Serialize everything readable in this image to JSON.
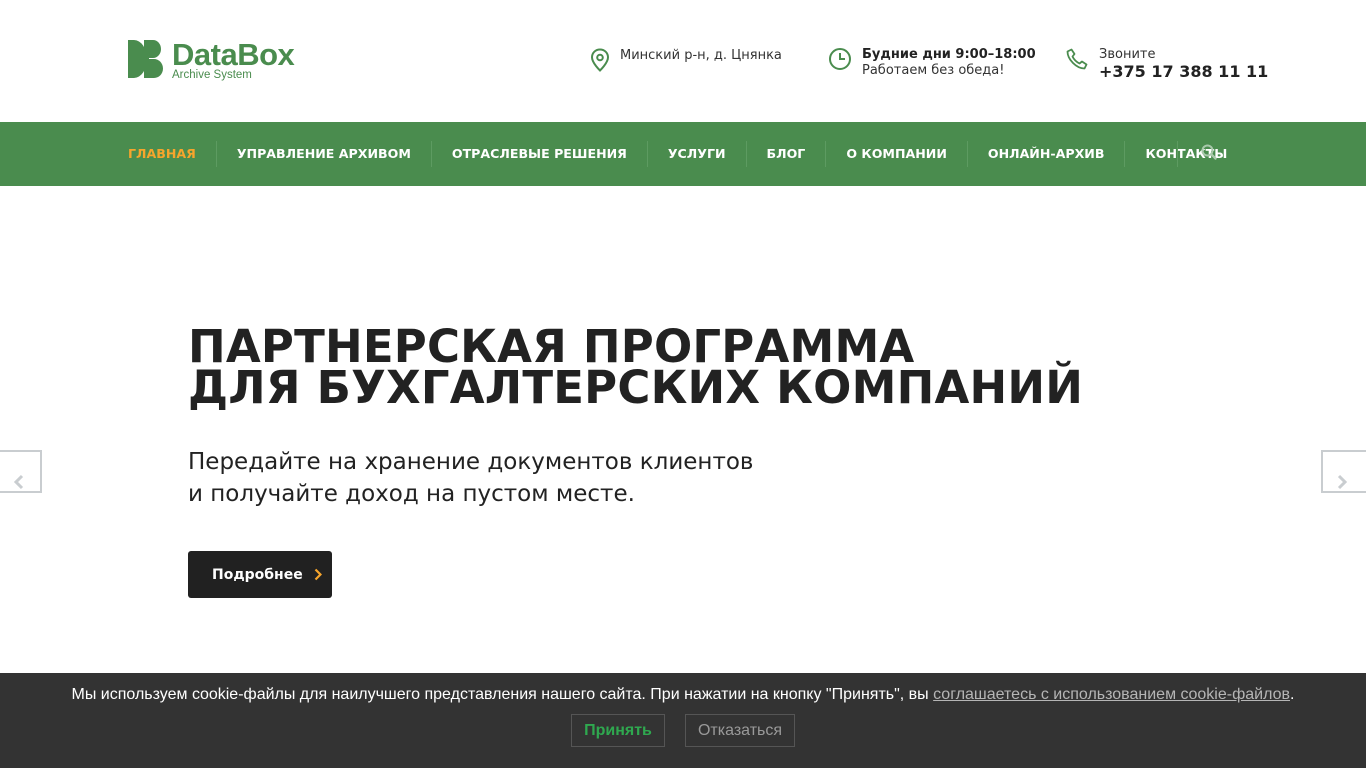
{
  "header": {
    "logo": {
      "name": "DataBox",
      "tagline": "Archive System"
    },
    "location": {
      "icon": "map-pin-icon",
      "text": "Минский р-н, д. Цнянка"
    },
    "hours": {
      "icon": "clock-icon",
      "title": "Будние дни 9:00–18:00",
      "note": "Работаем без обеда!"
    },
    "phone": {
      "icon": "phone-icon",
      "label": "Звоните",
      "number": "+375 17 388 11 11"
    }
  },
  "nav": {
    "items": [
      {
        "label": "ГЛАВНАЯ",
        "active": true
      },
      {
        "label": "УПРАВЛЕНИЕ АРХИВОМ"
      },
      {
        "label": "ОТРАСЛЕВЫЕ РЕШЕНИЯ"
      },
      {
        "label": "УСЛУГИ"
      },
      {
        "label": "БЛОГ"
      },
      {
        "label": "О КОМПАНИИ"
      },
      {
        "label": "ОНЛАЙН-АРХИВ"
      },
      {
        "label": "КОНТАКТЫ"
      }
    ],
    "search_icon": "search-icon"
  },
  "hero": {
    "title_line1": "ПАРТНЕРСКАЯ ПРОГРАММА",
    "title_line2": "ДЛЯ БУХГАЛТЕРСКИХ КОМПАНИЙ",
    "subtitle_line1": "Передайте на хранение документов клиентов",
    "subtitle_line2": "и получайте доход на пустом месте.",
    "button_label": "Подробнее"
  },
  "slider": {
    "prev_icon": "chevron-left-icon",
    "next_icon": "chevron-right-icon"
  },
  "cookie": {
    "text": "Мы используем cookie-файлы для наилучшего представления нашего сайта. При нажатии на кнопку \"Принять\", вы ",
    "link": "соглашаетесь с использованием cookie-файлов",
    "end": ".",
    "accept": "Принять",
    "decline": "Отказаться"
  },
  "colors": {
    "brand_green": "#4a8c4e",
    "accent_orange": "#f6a52c",
    "cookie_bg": "#333333",
    "accept_green": "#2fa84f"
  }
}
